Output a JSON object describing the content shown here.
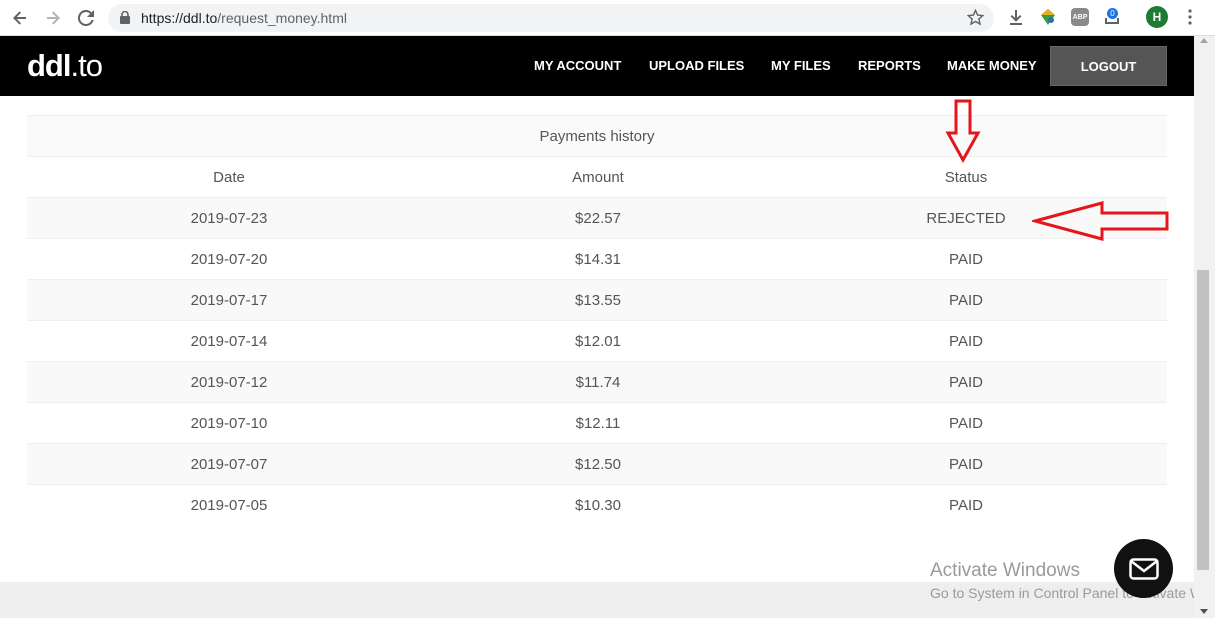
{
  "browser": {
    "url_host": "https://ddl.to",
    "url_path": "/request_money.html",
    "profile_initial": "H",
    "ext_abp_label": "ABP",
    "ext_badge_count": "0"
  },
  "site": {
    "logo_main": "ddl",
    "logo_tld": ".to",
    "nav": {
      "my_account": "MY ACCOUNT",
      "upload_files": "UPLOAD FILES",
      "my_files": "MY FILES",
      "reports": "REPORTS",
      "make_money": "MAKE MONEY",
      "logout": "LOGOUT"
    }
  },
  "payments": {
    "title": "Payments history",
    "headers": {
      "date": "Date",
      "amount": "Amount",
      "status": "Status"
    },
    "rows": [
      {
        "date": "2019-07-23",
        "amount": "$22.57",
        "status": "REJECTED"
      },
      {
        "date": "2019-07-20",
        "amount": "$14.31",
        "status": "PAID"
      },
      {
        "date": "2019-07-17",
        "amount": "$13.55",
        "status": "PAID"
      },
      {
        "date": "2019-07-14",
        "amount": "$12.01",
        "status": "PAID"
      },
      {
        "date": "2019-07-12",
        "amount": "$11.74",
        "status": "PAID"
      },
      {
        "date": "2019-07-10",
        "amount": "$12.11",
        "status": "PAID"
      },
      {
        "date": "2019-07-07",
        "amount": "$12.50",
        "status": "PAID"
      },
      {
        "date": "2019-07-05",
        "amount": "$10.30",
        "status": "PAID"
      }
    ]
  },
  "watermark": {
    "line1": "Activate Windows",
    "line2": "Go to System in Control Panel to activate Windows."
  },
  "colors": {
    "header_bg": "#000000",
    "logout_bg": "#555555",
    "annotation_red": "#e3161b",
    "profile_green": "#1e7b34"
  },
  "icons": {
    "back": "arrow-left-icon",
    "forward": "arrow-right-icon",
    "reload": "reload-icon",
    "lock": "lock-icon",
    "bookmark": "star-icon",
    "download": "download-icon",
    "chat": "mail-icon"
  }
}
